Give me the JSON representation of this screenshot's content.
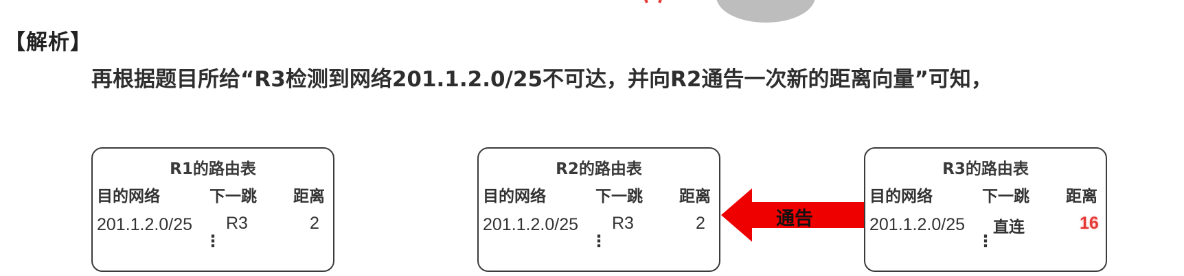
{
  "heading": "【解析】",
  "statement": "再根据题目所给“R3检测到网络201.1.2.0/25不可达，并向R2通告一次新的距离向量”可知，",
  "tables": [
    {
      "title": "R1的路由表",
      "headers": [
        "目的网络",
        "下一跳",
        "距离"
      ],
      "row": {
        "network": "201.1.2.0/25",
        "next_hop": "R3",
        "distance": "2"
      },
      "ellipsis": "⋮"
    },
    {
      "title": "R2的路由表",
      "headers": [
        "目的网络",
        "下一跳",
        "距离"
      ],
      "row": {
        "network": "201.1.2.0/25",
        "next_hop": "R3",
        "distance": "2"
      },
      "ellipsis": "⋮"
    },
    {
      "title": "R3的路由表",
      "headers": [
        "目的网络",
        "下一跳",
        "距离"
      ],
      "row": {
        "network": "201.1.2.0/25",
        "next_hop": "直连",
        "distance": "16"
      },
      "ellipsis": "⋮"
    }
  ],
  "arrow_label": "通告",
  "colors": {
    "arrow": "#ee0000",
    "highlight": "#e53935",
    "cloud": "#bdbdbd"
  }
}
